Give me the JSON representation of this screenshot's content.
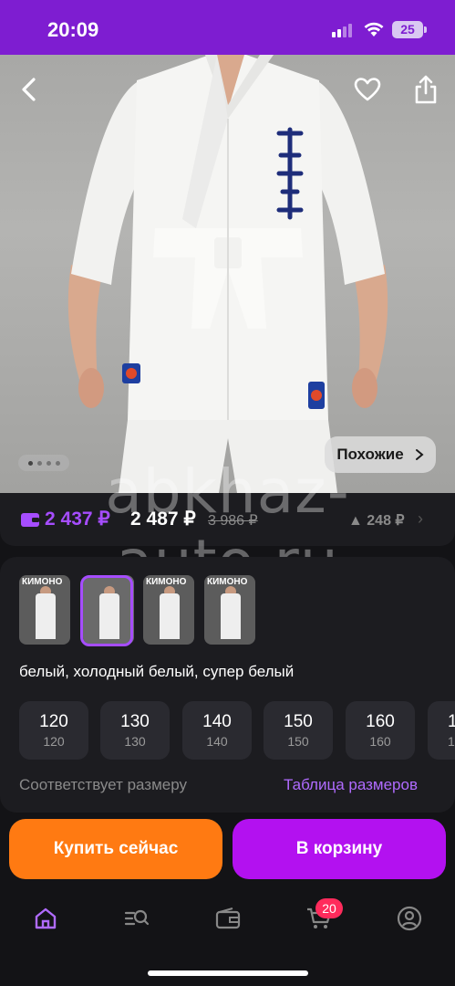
{
  "status_bar": {
    "time": "20:09",
    "battery": "25"
  },
  "gallery": {
    "similar_label": "Похожие",
    "watermark": "abkhaz-auto.ru"
  },
  "price": {
    "wallet_price": "2 437 ₽",
    "price": "2 487 ₽",
    "old_price": "3 986 ₽",
    "price_change": "▲ 248 ₽"
  },
  "variants": {
    "thumbnails": [
      {
        "title": "КИМОНО"
      },
      {
        "title": ""
      },
      {
        "title": "КИМОНО"
      },
      {
        "title": "КИМОНО"
      }
    ],
    "selected_index": 1,
    "color_text": "белый, холодный белый, супер белый"
  },
  "sizes": [
    {
      "label": "120",
      "sub": "120"
    },
    {
      "label": "130",
      "sub": "130"
    },
    {
      "label": "140",
      "sub": "140"
    },
    {
      "label": "150",
      "sub": "150"
    },
    {
      "label": "160",
      "sub": "160"
    },
    {
      "label": "1",
      "sub": "1"
    }
  ],
  "fit": {
    "text": "Соответствует размеру",
    "size_table_link": "Таблица размеров"
  },
  "actions": {
    "buy_now": "Купить сейчас",
    "add_to_cart": "В корзину"
  },
  "tab_bar": {
    "cart_count": "20",
    "items": [
      "home-icon",
      "catalog-search-icon",
      "wallet-icon",
      "cart-icon",
      "profile-icon"
    ]
  },
  "colors": {
    "brand_purple": "#7e1dd1",
    "accent_purple": "#a64dff",
    "orange": "#ff7a12",
    "magenta": "#b311f0",
    "badge_red": "#ff2b5c"
  }
}
